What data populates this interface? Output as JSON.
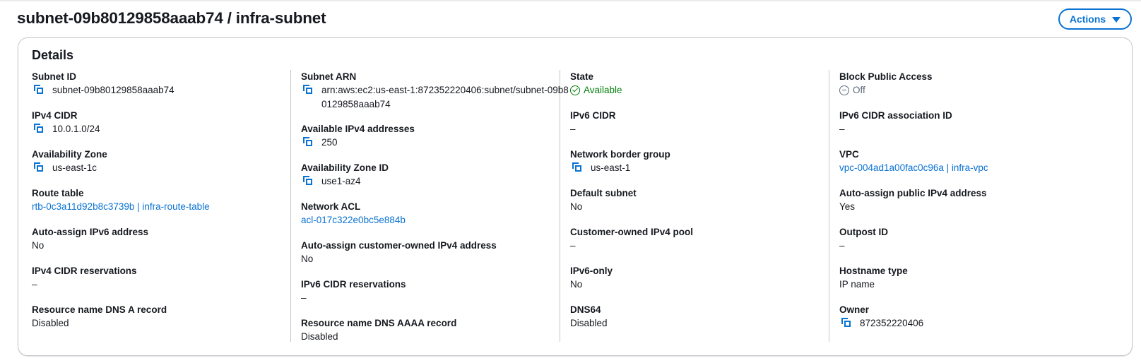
{
  "header": {
    "title": "subnet-09b80129858aaab74 / infra-subnet",
    "actions_label": "Actions"
  },
  "details": {
    "heading": "Details",
    "col1": {
      "subnet_id": {
        "label": "Subnet ID",
        "value": "subnet-09b80129858aaab74"
      },
      "ipv4_cidr": {
        "label": "IPv4 CIDR",
        "value": "10.0.1.0/24"
      },
      "availability_zone": {
        "label": "Availability Zone",
        "value": "us-east-1c"
      },
      "route_table": {
        "label": "Route table",
        "value": "rtb-0c3a11d92b8c3739b | infra-route-table"
      },
      "auto_assign_ipv6": {
        "label": "Auto-assign IPv6 address",
        "value": "No"
      },
      "ipv4_cidr_reservations": {
        "label": "IPv4 CIDR reservations",
        "value": "–"
      },
      "dns_a_record": {
        "label": "Resource name DNS A record",
        "value": "Disabled"
      }
    },
    "col2": {
      "subnet_arn": {
        "label": "Subnet ARN",
        "value": "arn:aws:ec2:us-east-1:872352220406:subnet/subnet-09b80129858aaab74"
      },
      "available_ipv4": {
        "label": "Available IPv4 addresses",
        "value": "250"
      },
      "az_id": {
        "label": "Availability Zone ID",
        "value": "use1-az4"
      },
      "network_acl": {
        "label": "Network ACL",
        "value": "acl-017c322e0bc5e884b"
      },
      "auto_assign_customer_ipv4": {
        "label": "Auto-assign customer-owned IPv4 address",
        "value": "No"
      },
      "ipv6_cidr_reservations": {
        "label": "IPv6 CIDR reservations",
        "value": "–"
      },
      "dns_aaaa_record": {
        "label": "Resource name DNS AAAA record",
        "value": "Disabled"
      }
    },
    "col3": {
      "state": {
        "label": "State",
        "value": "Available",
        "color": "#037f0c",
        "icon": "check-circle-icon"
      },
      "ipv6_cidr": {
        "label": "IPv6 CIDR",
        "value": "–"
      },
      "network_border_group": {
        "label": "Network border group",
        "value": "us-east-1"
      },
      "default_subnet": {
        "label": "Default subnet",
        "value": "No"
      },
      "customer_owned_pool": {
        "label": "Customer-owned IPv4 pool",
        "value": "–"
      },
      "ipv6_only": {
        "label": "IPv6-only",
        "value": "No"
      },
      "dns64": {
        "label": "DNS64",
        "value": "Disabled"
      }
    },
    "col4": {
      "block_public_access": {
        "label": "Block Public Access",
        "value": "Off",
        "icon": "stopped-icon"
      },
      "ipv6_cidr_association_id": {
        "label": "IPv6 CIDR association ID",
        "value": "–"
      },
      "vpc": {
        "label": "VPC",
        "value": "vpc-004ad1a00fac0c96a | infra-vpc"
      },
      "auto_assign_public_ipv4": {
        "label": "Auto-assign public IPv4 address",
        "value": "Yes"
      },
      "outpost_id": {
        "label": "Outpost ID",
        "value": "–"
      },
      "hostname_type": {
        "label": "Hostname type",
        "value": "IP name"
      },
      "owner": {
        "label": "Owner",
        "value": "872352220406"
      }
    }
  },
  "colors": {
    "link": "#0972d3",
    "success": "#037f0c",
    "muted": "#5f6b7a",
    "border": "#c6c6cd"
  }
}
